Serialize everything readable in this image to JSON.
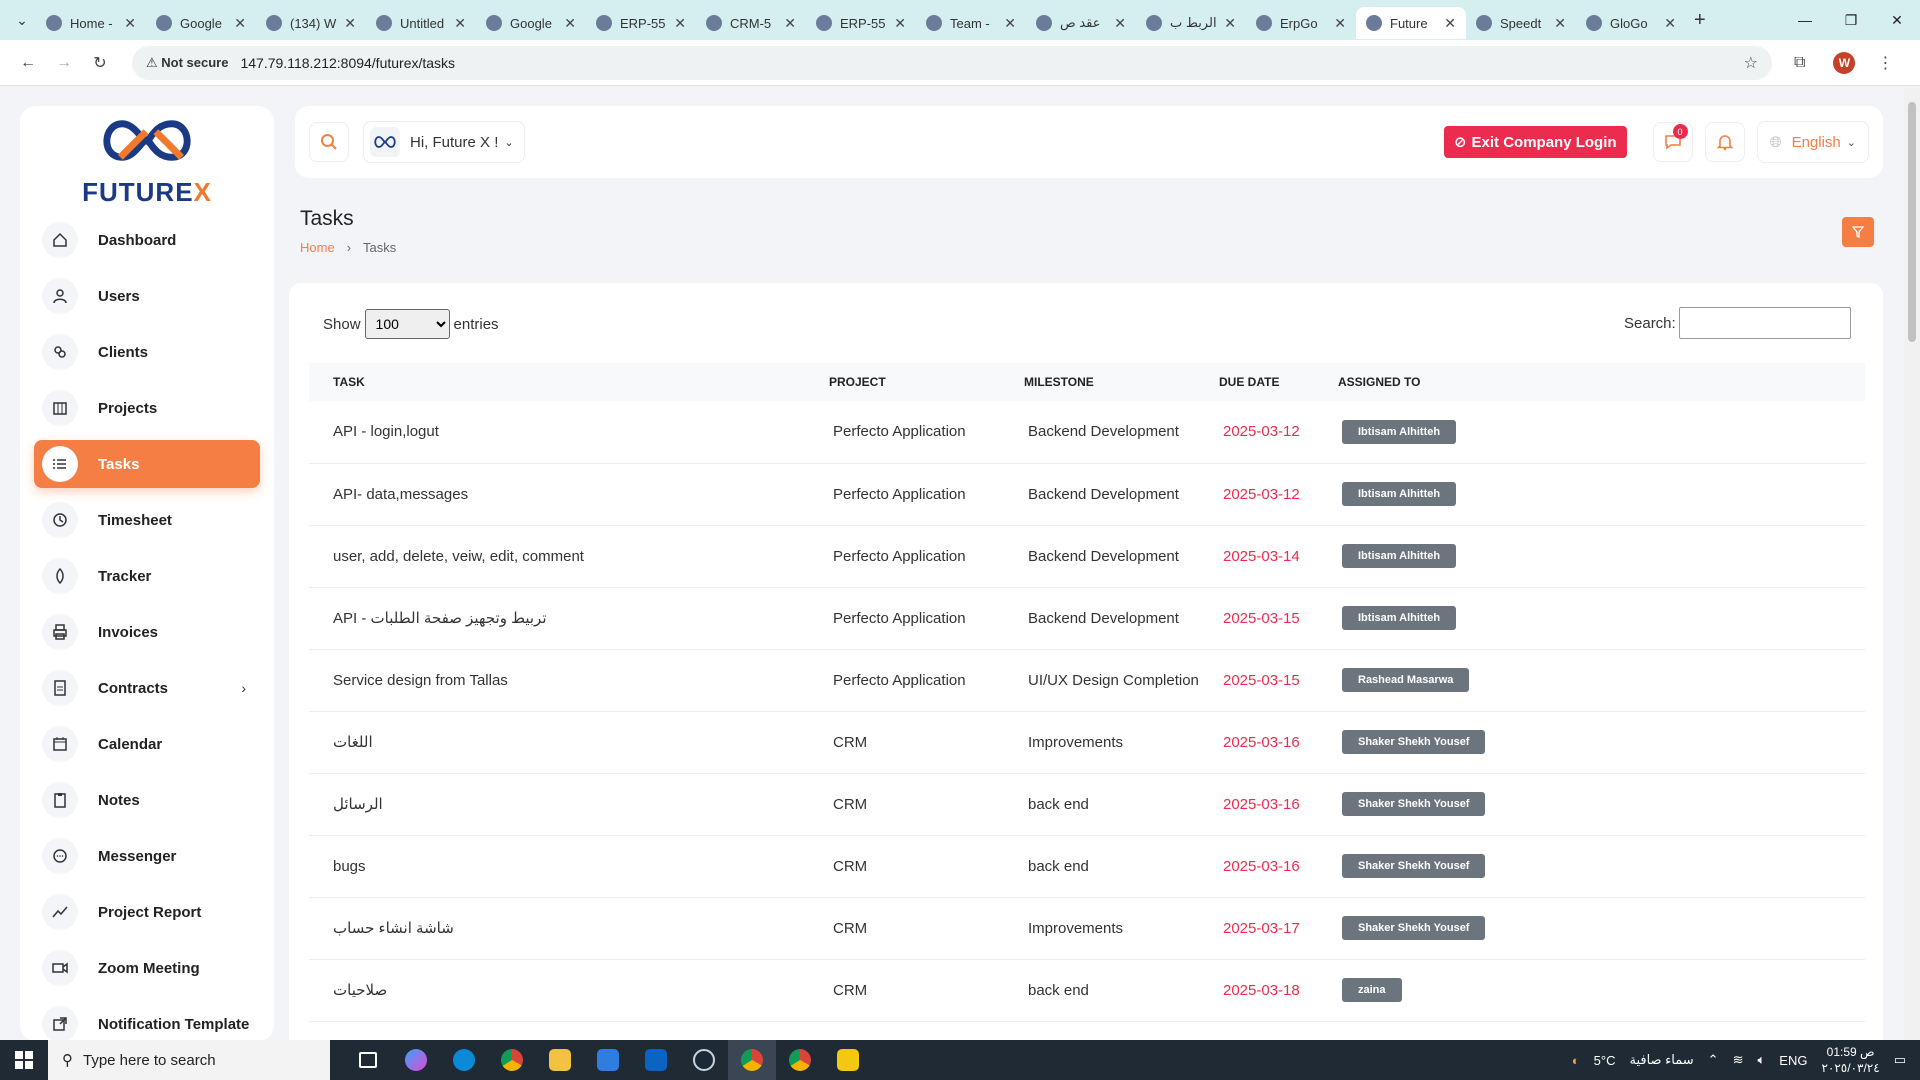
{
  "browser": {
    "tabs": [
      {
        "title": "Home -",
        "active": false
      },
      {
        "title": "Google",
        "active": false
      },
      {
        "title": "(134) W",
        "active": false
      },
      {
        "title": "Untitled",
        "active": false
      },
      {
        "title": "Google",
        "active": false
      },
      {
        "title": "ERP-55",
        "active": false
      },
      {
        "title": "CRM-5",
        "active": false
      },
      {
        "title": "ERP-55",
        "active": false
      },
      {
        "title": "Team -",
        "active": false
      },
      {
        "title": "عقد ص",
        "active": false
      },
      {
        "title": "الربط ب",
        "active": false
      },
      {
        "title": "ErpGo",
        "active": false
      },
      {
        "title": "Future",
        "active": true
      },
      {
        "title": "Speedt",
        "active": false
      },
      {
        "title": "GloGo",
        "active": false
      }
    ],
    "security_label": "Not secure",
    "url": "147.79.118.212:8094/futurex/tasks",
    "profile_initial": "W"
  },
  "brand": {
    "name_main": "FUTURE",
    "name_accent": "X"
  },
  "sidebar": {
    "items": [
      {
        "label": "Dashboard",
        "icon": "home-icon",
        "active": false
      },
      {
        "label": "Users",
        "icon": "user-icon",
        "active": false
      },
      {
        "label": "Clients",
        "icon": "clients-icon",
        "active": false
      },
      {
        "label": "Projects",
        "icon": "projects-icon",
        "active": false
      },
      {
        "label": "Tasks",
        "icon": "list-icon",
        "active": true
      },
      {
        "label": "Timesheet",
        "icon": "clock-icon",
        "active": false
      },
      {
        "label": "Tracker",
        "icon": "tracker-icon",
        "active": false
      },
      {
        "label": "Invoices",
        "icon": "printer-icon",
        "active": false
      },
      {
        "label": "Contracts",
        "icon": "contract-icon",
        "active": false,
        "has_submenu": true
      },
      {
        "label": "Calendar",
        "icon": "calendar-icon",
        "active": false
      },
      {
        "label": "Notes",
        "icon": "clipboard-icon",
        "active": false
      },
      {
        "label": "Messenger",
        "icon": "chat-icon",
        "active": false
      },
      {
        "label": "Project Report",
        "icon": "chart-icon",
        "active": false
      },
      {
        "label": "Zoom Meeting",
        "icon": "video-icon",
        "active": false
      },
      {
        "label": "Notification Template",
        "icon": "external-icon",
        "active": false
      }
    ]
  },
  "header": {
    "greeting": "Hi, Future X !",
    "exit_label": "Exit Company Login",
    "message_count": "0",
    "language": "English"
  },
  "page": {
    "title": "Tasks",
    "breadcrumb_home": "Home",
    "breadcrumb_current": "Tasks"
  },
  "table": {
    "show_label": "Show",
    "entries_value": "100",
    "entries_label": "entries",
    "search_label": "Search:",
    "columns": [
      "TASK",
      "PROJECT",
      "MILESTONE",
      "DUE DATE",
      "ASSIGNED TO"
    ],
    "rows": [
      {
        "task": "API - login,logut",
        "project": "Perfecto Application",
        "milestone": "Backend Development",
        "due": "2025-03-12",
        "assignee": "Ibtisam Alhitteh"
      },
      {
        "task": "API- data,messages",
        "project": "Perfecto Application",
        "milestone": "Backend Development",
        "due": "2025-03-12",
        "assignee": "Ibtisam Alhitteh"
      },
      {
        "task": "user, add, delete, veiw, edit, comment",
        "project": "Perfecto Application",
        "milestone": "Backend Development",
        "due": "2025-03-14",
        "assignee": "Ibtisam Alhitteh"
      },
      {
        "task": "API - تربيط وتجهيز صفحة الطلبات",
        "project": "Perfecto Application",
        "milestone": "Backend Development",
        "due": "2025-03-15",
        "assignee": "Ibtisam Alhitteh"
      },
      {
        "task": "Service design from Tallas",
        "project": "Perfecto Application",
        "milestone": "UI/UX Design Completion",
        "due": "2025-03-15",
        "assignee": "Rashead Masarwa"
      },
      {
        "task": "اللغات",
        "project": "CRM",
        "milestone": "Improvements",
        "due": "2025-03-16",
        "assignee": "Shaker Shekh Yousef"
      },
      {
        "task": "الرسائل",
        "project": "CRM",
        "milestone": "back end",
        "due": "2025-03-16",
        "assignee": "Shaker Shekh Yousef"
      },
      {
        "task": "bugs",
        "project": "CRM",
        "milestone": "back end",
        "due": "2025-03-16",
        "assignee": "Shaker Shekh Yousef"
      },
      {
        "task": "شاشة انشاء حساب",
        "project": "CRM",
        "milestone": "Improvements",
        "due": "2025-03-17",
        "assignee": "Shaker Shekh Yousef"
      },
      {
        "task": "صلاحيات",
        "project": "CRM",
        "milestone": "back end",
        "due": "2025-03-18",
        "assignee": "zaina"
      }
    ]
  },
  "taskbar": {
    "search_placeholder": "Type here to search",
    "weather_temp": "5°C",
    "weather_desc": "سماء صافية",
    "lang": "ENG",
    "time": "01:59 ص",
    "date": "٢٠٢٥/٠٣/٢٤"
  },
  "colors": {
    "accent": "#f47e44",
    "danger": "#ec2c4e",
    "brand_blue": "#1b3a86"
  }
}
